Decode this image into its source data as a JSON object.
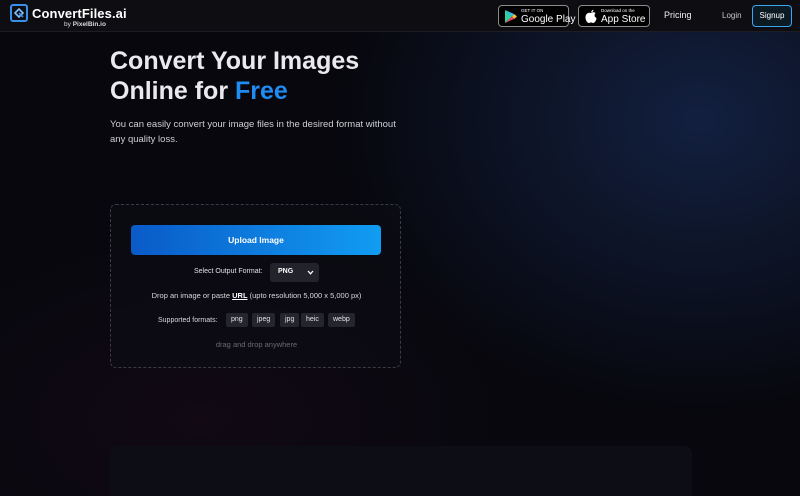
{
  "brand": {
    "name": "ConvertFiles.ai",
    "by_prefix": "by",
    "by_name": "PixelBin.io"
  },
  "header": {
    "google_play_small": "GET IT ON",
    "google_play_big": "Google Play",
    "app_store_small": "Download on the",
    "app_store_big": "App Store",
    "pricing": "Pricing",
    "login": "Login",
    "signup": "Signup"
  },
  "hero": {
    "title_line1": "Convert Your Images",
    "title_line2_prefix": "Online for",
    "title_line2_accent": "Free",
    "description": "You can easily convert your image files in the desired format without any quality loss."
  },
  "upload": {
    "button_label": "Upload Image",
    "format_label": "Select Output Format:",
    "format_value": "PNG",
    "drop_prefix": "Drop an image or paste",
    "drop_url": "URL",
    "drop_suffix": "(upto resolution 5,000 x 5,000 px)",
    "supported_label": "Supported formats:",
    "formats": [
      "png",
      "jpeg",
      "jpg",
      "heic",
      "webp"
    ],
    "drag_hint": "drag and drop anywhere"
  },
  "colors": {
    "accent": "#1e8cf2",
    "background": "#07070d",
    "signup_border": "#3aa6f0"
  }
}
